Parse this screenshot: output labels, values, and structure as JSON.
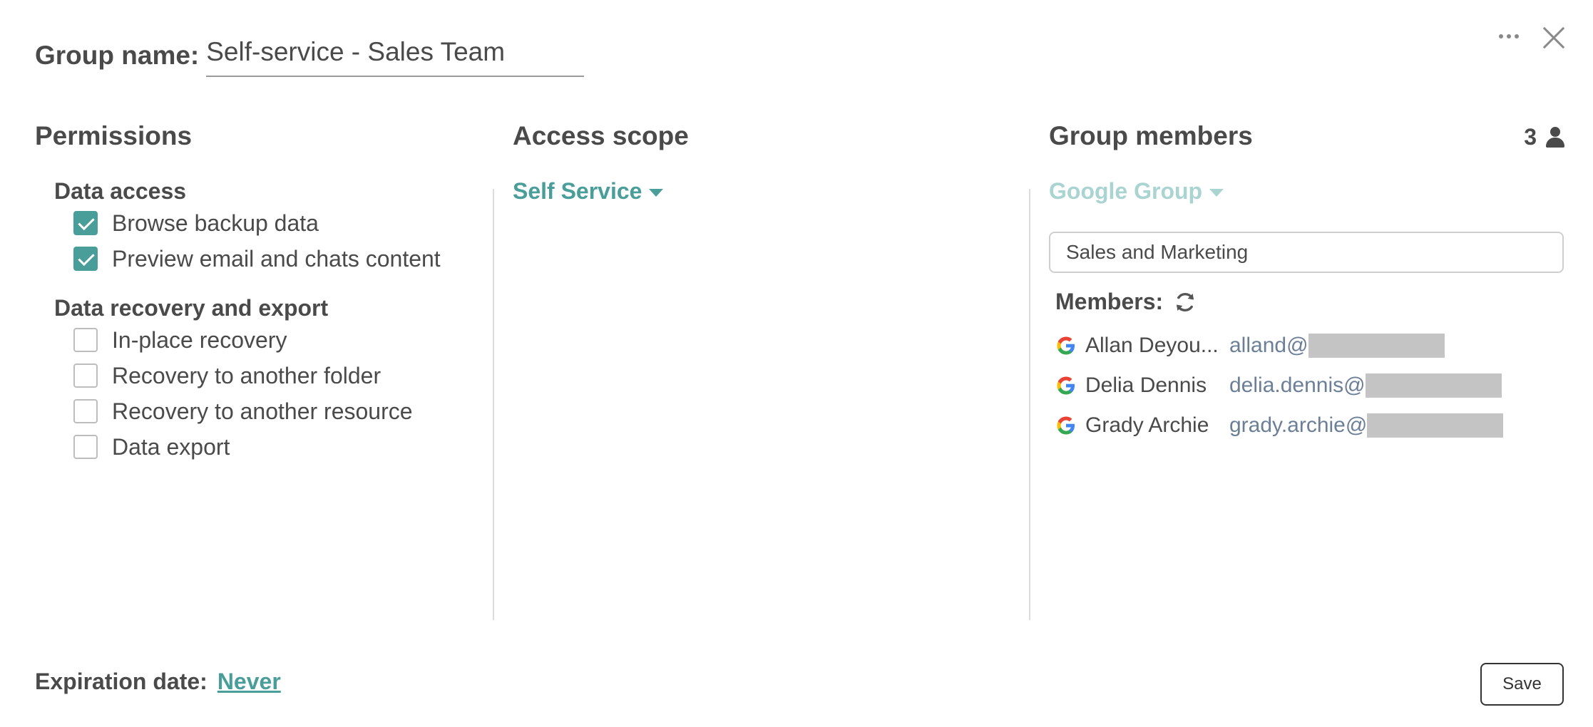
{
  "header": {
    "group_name_label": "Group name:",
    "group_name_value": "Self-service - Sales Team"
  },
  "permissions": {
    "title": "Permissions",
    "data_access": {
      "title": "Data access",
      "items": [
        {
          "label": "Browse backup data",
          "checked": true
        },
        {
          "label": "Preview email and chats content",
          "checked": true
        }
      ]
    },
    "recovery": {
      "title": "Data recovery and export",
      "items": [
        {
          "label": "In-place recovery",
          "checked": false
        },
        {
          "label": "Recovery to another folder",
          "checked": false
        },
        {
          "label": "Recovery to another resource",
          "checked": false
        },
        {
          "label": "Data export",
          "checked": false
        }
      ]
    }
  },
  "access_scope": {
    "title": "Access scope",
    "selected": "Self Service"
  },
  "group_members": {
    "title": "Group members",
    "count": "3",
    "source": "Google Group",
    "group_value": "Sales and Marketing",
    "members_label": "Members:",
    "members": [
      {
        "name": "Allan Deyou...",
        "email_prefix": "alland@"
      },
      {
        "name": "Delia Dennis",
        "email_prefix": "delia.dennis@"
      },
      {
        "name": "Grady Archie",
        "email_prefix": "grady.archie@"
      }
    ]
  },
  "footer": {
    "expiration_label": "Expiration date:",
    "expiration_value": "Never",
    "save_label": "Save"
  },
  "colors": {
    "accent": "#4a9e9a",
    "accent_light": "#a9d4d1",
    "email": "#6b7f96",
    "redaction": "#c4c4c4"
  }
}
